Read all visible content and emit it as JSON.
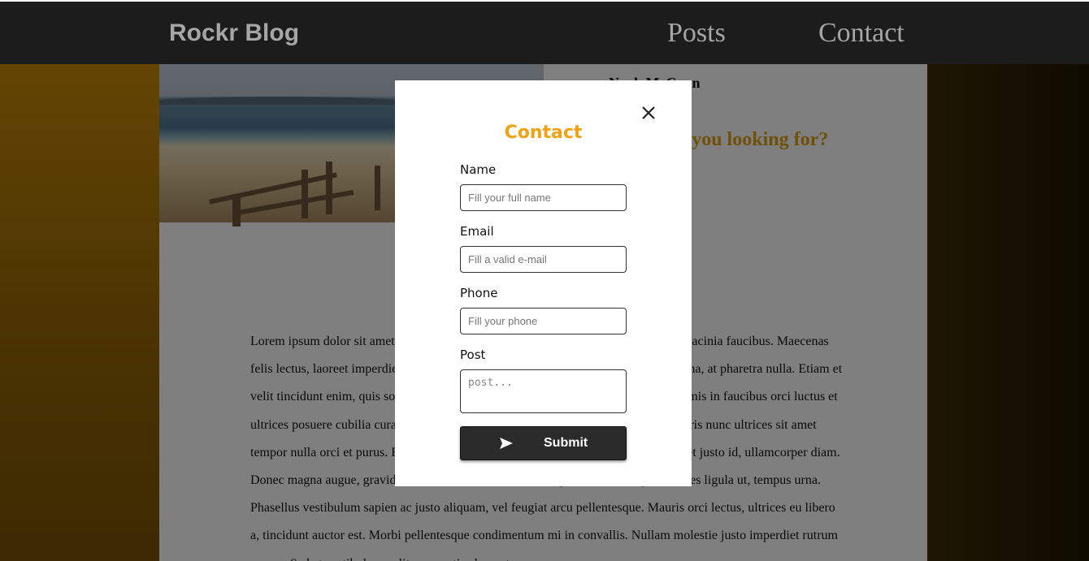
{
  "navbar": {
    "brand": "Rockr Blog",
    "links": [
      "Posts",
      "Contact"
    ]
  },
  "article": {
    "author": "Noah McCann",
    "question": "What are you looking for?",
    "body": "Lorem ipsum dolor sit amet, consectetur adipiscing elit. Curabitur quis arcu at nunc lacinia faucibus. Maecenas felis lectus, laoreet imperdiet vitae, scelerisque auctor magna. Morbi porta lacinia urna, at pharetra nulla. Etiam et velit tincidunt enim, quis sollicitudin dolor sem ac ligula. Vestibulum ante ipsum primis in faucibus orci luctus et ultrices posuere cubilia curae; Nulla dignissim, lectus non vehicula sollicitudin, mauris nunc ultrices sit amet tempor nulla orci et purus. Fusce eu finibus orci. Donec vel lectus lacus. Nunc laoreet justo id, ullamcorper diam. Donec magna augue, gravida ac dolor sit amet, efficitur vulputate nisi. Integer, sodales ligula ut, tempus urna. Phasellus vestibulum sapien ac justo aliquam, vel feugiat arcu pellentesque. Mauris orci lectus, ultrices eu libero a, tincidunt auctor est. Morbi pellentesque condimentum mi in convallis. Nullam molestie justo imperdiet rutrum ornare. Sed et vestibulum velit, venenatis elementum augue."
  },
  "modal": {
    "title": "Contact",
    "fields": {
      "name": {
        "label": "Name",
        "placeholder": "Fill your full name"
      },
      "email": {
        "label": "Email",
        "placeholder": "Fill a valid e-mail"
      },
      "phone": {
        "label": "Phone",
        "placeholder": "Fill your phone"
      },
      "post": {
        "label": "Post",
        "placeholder": "post..."
      }
    },
    "submit_label": "Submit",
    "icons": {
      "close": "close-icon",
      "submit": "send-icon"
    }
  },
  "colors": {
    "accent": "#f0a214",
    "navbar_bg": "#1c1c1c",
    "button_bg": "#2b2b2b"
  }
}
